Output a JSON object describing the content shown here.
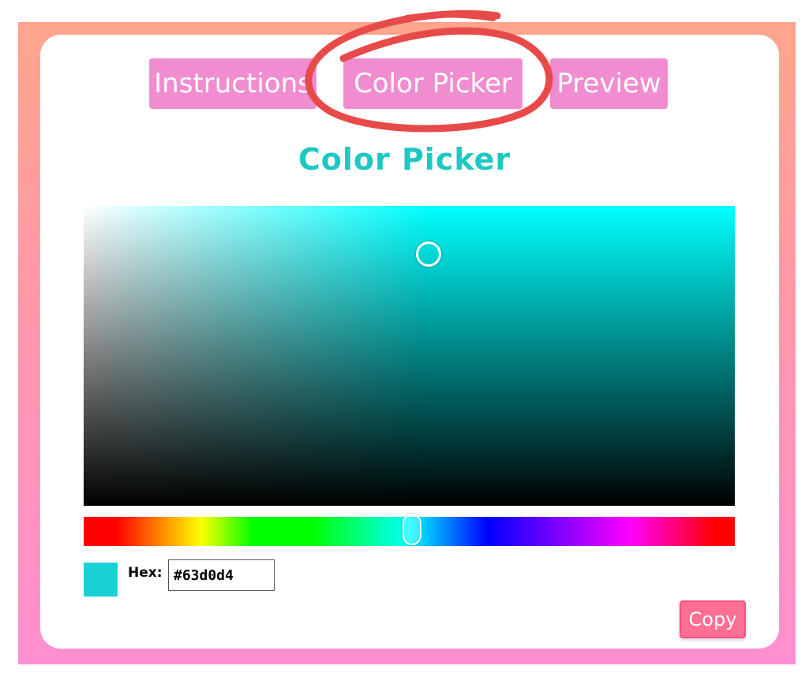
{
  "tabs": [
    {
      "label": "Instructions"
    },
    {
      "label": "Color Picker"
    },
    {
      "label": "Preview"
    }
  ],
  "page": {
    "title": "Color Picker"
  },
  "picker": {
    "saturation": 0.53,
    "value": 0.83,
    "hue": 182,
    "hue_position_fraction": 0.5
  },
  "hex": {
    "label": "Hex:",
    "value": "#63d0d4",
    "swatch_color": "#18d2d6"
  },
  "copy": {
    "label": "Copy"
  },
  "colors": {
    "tab_bg": "#f08cd0",
    "title": "#1ec8c2",
    "annotation_circle": "#e84a4a",
    "frame_top": "#ffa58c",
    "frame_bottom": "#ff8fd0",
    "copy_bg": "#ff6f94"
  },
  "icons": {
    "annotation": "red-hand-drawn-circle"
  }
}
